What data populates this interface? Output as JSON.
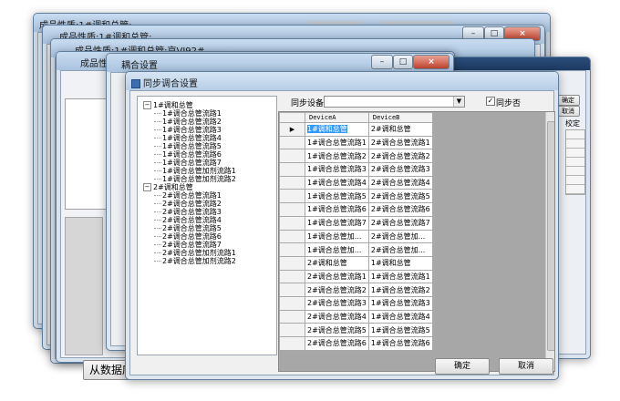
{
  "bg_windows": {
    "w1_title": "成品性质:1#调和总管:",
    "w1_title2": "成品性质:1#调和总管:",
    "w1_side_label": "设",
    "w2_title": "成品性质:1#调和总管:京VI92#",
    "w2_title_suffix": "",
    "w3_title": "成品性质:1#调和总管:京VI92#",
    "w4_title": "耦合设置",
    "w4_sub_title": "耦合",
    "bottom_left_button": "从数据库",
    "right_buttons": [
      "确定",
      "取消"
    ],
    "right_col_label": "校定"
  },
  "dialog": {
    "title": "同步调合设置",
    "sync_device_label": "同步设备：",
    "sync_device_value": "",
    "sync_checkbox_label": "同步否",
    "sync_checked": true,
    "ok_label": "确定",
    "cancel_label": "取消"
  },
  "tree": [
    {
      "label": "1#调和总管",
      "level": 0,
      "expanded": true
    },
    {
      "label": "1#调合总管流路1",
      "level": 1
    },
    {
      "label": "1#调合总管流路2",
      "level": 1
    },
    {
      "label": "1#调合总管流路3",
      "level": 1
    },
    {
      "label": "1#调合总管流路4",
      "level": 1
    },
    {
      "label": "1#调合总管流路5",
      "level": 1
    },
    {
      "label": "1#调合总管流路6",
      "level": 1
    },
    {
      "label": "1#调合总管流路7",
      "level": 1
    },
    {
      "label": "1#调合总管加剂流路1",
      "level": 1
    },
    {
      "label": "1#调合总管加剂流路2",
      "level": 1
    },
    {
      "label": "2#调和总管",
      "level": 0,
      "expanded": true
    },
    {
      "label": "2#调合总管流路1",
      "level": 1
    },
    {
      "label": "2#调合总管流路2",
      "level": 1
    },
    {
      "label": "2#调合总管流路3",
      "level": 1
    },
    {
      "label": "2#调合总管流路4",
      "level": 1
    },
    {
      "label": "2#调合总管流路5",
      "level": 1
    },
    {
      "label": "2#调合总管流路6",
      "level": 1
    },
    {
      "label": "2#调合总管流路7",
      "level": 1
    },
    {
      "label": "2#调合总管加剂流路1",
      "level": 1
    },
    {
      "label": "2#调合总管加剂流路2",
      "level": 1
    }
  ],
  "grid": {
    "columns": [
      "DeviceA",
      "DeviceB"
    ],
    "rows": [
      [
        "1#调和总管",
        "2#调和总管"
      ],
      [
        "1#调合总管流路1",
        "2#调合总管流路1"
      ],
      [
        "1#调合总管流路2",
        "2#调合总管流路2"
      ],
      [
        "1#调合总管流路3",
        "2#调合总管流路3"
      ],
      [
        "1#调合总管流路4",
        "2#调合总管流路4"
      ],
      [
        "1#调合总管流路5",
        "2#调合总管流路5"
      ],
      [
        "1#调合总管流路6",
        "2#调合总管流路6"
      ],
      [
        "1#调合总管流路7",
        "2#调合总管流路7"
      ],
      [
        "1#调合总管加...",
        "2#调合总管加..."
      ],
      [
        "1#调合总管加...",
        "2#调合总管加..."
      ],
      [
        "2#调和总管",
        "1#调和总管"
      ],
      [
        "2#调合总管流路1",
        "1#调合总管流路1"
      ],
      [
        "2#调合总管流路2",
        "1#调合总管流路2"
      ],
      [
        "2#调合总管流路3",
        "1#调合总管流路3"
      ],
      [
        "2#调合总管流路4",
        "1#调合总管流路4"
      ],
      [
        "2#调合总管流路5",
        "1#调合总管流路5"
      ],
      [
        "2#调合总管流路6",
        "1#调合总管流路6"
      ]
    ],
    "current_row_marker": "▶"
  },
  "colors": {
    "selection": "#3399ff",
    "titlebar": "#b7cee6",
    "grid_bg": "#a7a7a7"
  }
}
